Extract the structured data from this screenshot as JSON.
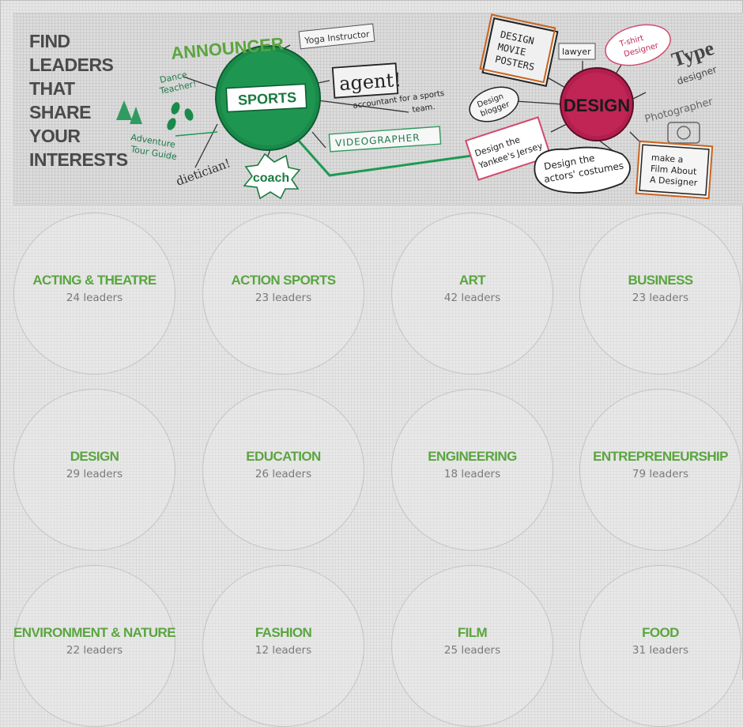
{
  "banner": {
    "headline": [
      "FIND",
      "LEADERS",
      "THAT SHARE",
      "YOUR",
      "INTERESTS"
    ],
    "doodles": {
      "announcer": "ANNOUNCER",
      "yoga": "Yoga Instructor",
      "sports": "SPORTS",
      "agent": "agent!",
      "dance_1": "Dance",
      "dance_2": "Teacher!",
      "accountant_1": "accountant for a sports",
      "accountant_2": "team.",
      "adventure_1": "Adventure",
      "adventure_2": "Tour Guide",
      "videographer": "VIDEOGRAPHER",
      "dietician": "dietician!",
      "coach": "coach",
      "posters_1": "DESIGN",
      "posters_2": "MOVIE",
      "posters_3": "POSTERS",
      "lawyer": "lawyer",
      "tshirt_1": "T-shirt",
      "tshirt_2": "Designer",
      "type_1": "Type",
      "type_2": "designer",
      "blogger_1": "Design",
      "blogger_2": "blogger",
      "design": "DESIGN",
      "photographer": "Photographer",
      "jersey_1": "Design the",
      "jersey_2": "Yankee's Jersey",
      "costumes_1": "Design the",
      "costumes_2": "actors' costumes",
      "film_1": "make a",
      "film_2": "Film About",
      "film_3": "A Designer"
    }
  },
  "colors": {
    "accent_green": "#5aa53f",
    "sports_green": "#1e8a4c",
    "design_magenta": "#b41e4f",
    "count_gray": "#7a7a7a"
  },
  "categories": [
    {
      "name": "ACTING & THEATRE",
      "count": "24 leaders"
    },
    {
      "name": "ACTION SPORTS",
      "count": "23 leaders"
    },
    {
      "name": "ART",
      "count": "42 leaders"
    },
    {
      "name": "BUSINESS",
      "count": "23 leaders"
    },
    {
      "name": "DESIGN",
      "count": "29 leaders"
    },
    {
      "name": "EDUCATION",
      "count": "26 leaders"
    },
    {
      "name": "ENGINEERING",
      "count": "18 leaders"
    },
    {
      "name": "ENTREPRENEURSHIP",
      "count": "79 leaders"
    },
    {
      "name": "ENVIRONMENT & NATURE",
      "count": "22 leaders"
    },
    {
      "name": "FASHION",
      "count": "12 leaders"
    },
    {
      "name": "FILM",
      "count": "25 leaders"
    },
    {
      "name": "FOOD",
      "count": "31 leaders"
    }
  ]
}
